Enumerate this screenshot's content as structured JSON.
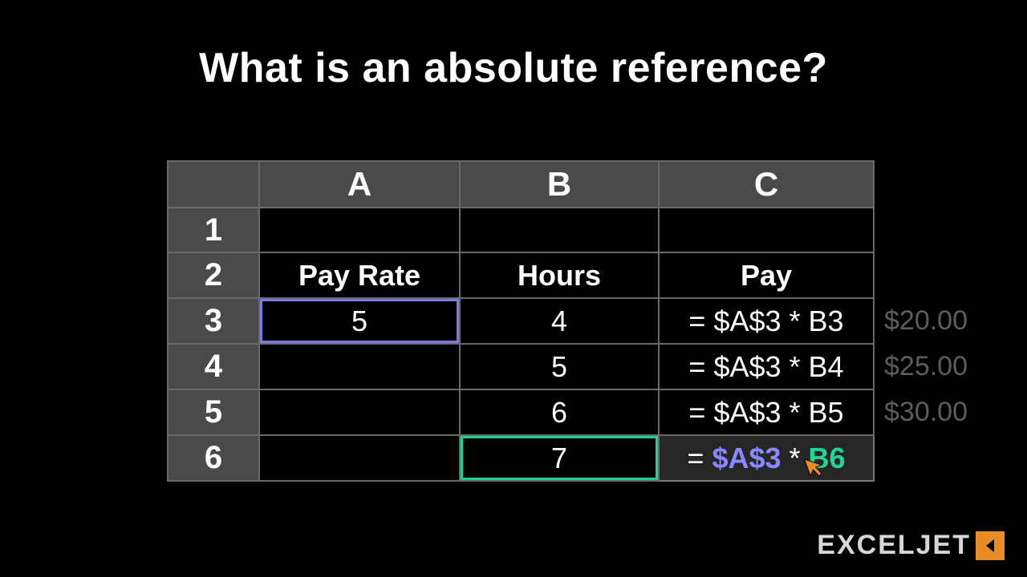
{
  "title": "What is an absolute reference?",
  "columns": [
    "A",
    "B",
    "C"
  ],
  "rowNumbers": [
    "1",
    "2",
    "3",
    "4",
    "5",
    "6"
  ],
  "headerRow": {
    "a": "Pay Rate",
    "b": "Hours",
    "c": "Pay"
  },
  "rows": [
    {
      "a": "5",
      "b": "4",
      "cPrefix": "= $A$3 * B3"
    },
    {
      "a": "",
      "b": "5",
      "cPrefix": "= $A$3 * B4"
    },
    {
      "a": "",
      "b": "6",
      "cPrefix": "= $A$3 * B5"
    },
    {
      "a": "",
      "b": "7",
      "cEq": "= ",
      "cAbs": "$A$3",
      "cMid": " * ",
      "cRel": "B6"
    }
  ],
  "results": [
    "$20.00",
    "$25.00",
    "$30.00"
  ],
  "brand": "EXCELJET"
}
